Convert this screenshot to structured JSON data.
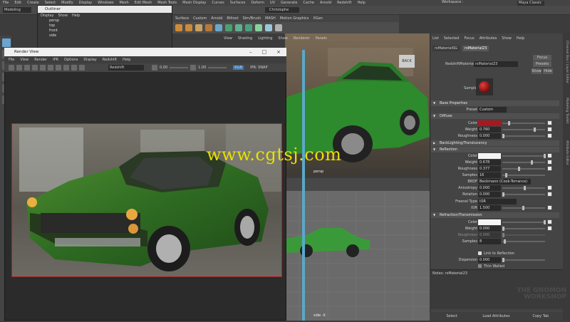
{
  "menubar": [
    "File",
    "Edit",
    "Create",
    "Select",
    "Modify",
    "Display",
    "Windows",
    "Mesh",
    "Edit Mesh",
    "Mesh Tools",
    "Mesh Display",
    "Curves",
    "Surfaces",
    "Deform",
    "UV",
    "Generate",
    "Cache",
    "Arnold",
    "Redshift",
    "Help"
  ],
  "workspace": {
    "label": "Workspace :",
    "value": "Maya Classic"
  },
  "status": {
    "mode": "Modeling",
    "user": "Christophe"
  },
  "shelf_tabs": [
    "Surface",
    "Custom",
    "Arnold",
    "Bifrost",
    "Sim/Brush",
    "MASH",
    "Motion Graphics",
    "XGen"
  ],
  "outliner": {
    "title": "Outliner",
    "menus": [
      "Display",
      "Show",
      "Help"
    ],
    "items": [
      "persp",
      "top",
      "front",
      "side"
    ]
  },
  "render_view": {
    "title": "Render View",
    "menus": [
      "File",
      "View",
      "Render",
      "IPR",
      "Options",
      "Display",
      "Redshift",
      "Help"
    ],
    "renderer": "Redshift",
    "exposure": "0.00",
    "gamma": "1.00",
    "mode": "RGB",
    "ipr_label": "IPR: SNAP"
  },
  "viewport": {
    "menus": [
      "View",
      "Shading",
      "Lighting",
      "Show",
      "Renderer",
      "Panels"
    ],
    "label": "persp",
    "side_label": "side -X"
  },
  "attribute_editor": {
    "menus": [
      "List",
      "Selected",
      "Focus",
      "Attributes",
      "Show",
      "Help"
    ],
    "tabs": [
      "rsMaterialSG",
      "rsMaterial23"
    ],
    "material_label": "RedshiftMaterial:",
    "material_name": "rsMaterial23",
    "buttons": {
      "focus": "Focus",
      "presets": "Presets",
      "show": "Show",
      "hide": "Hide"
    },
    "sample_label": "Sample",
    "base_properties": "Base Properties",
    "preset_label": "Preset",
    "preset_value": "Custom",
    "diffuse": {
      "title": "Diffuse",
      "color_label": "Color",
      "weight_label": "Weight",
      "weight": "0.760",
      "roughness_label": "Roughness",
      "roughness": "0.000",
      "diffuse_color": "#a81820"
    },
    "backlighting": "BackLighting/Translucency",
    "reflection": {
      "title": "Reflection",
      "color_label": "Color",
      "weight_label": "Weight",
      "weight": "0.678",
      "roughness_label": "Roughness",
      "roughness": "0.377",
      "samples_label": "Samples",
      "samples": "16",
      "brdf_label": "BRDF",
      "brdf": "Beckmann (Cook-Torrance)",
      "anisotropy_label": "Anisotropy",
      "anisotropy": "0.000",
      "rotation_label": "Rotation",
      "rotation": "0.000",
      "fresnel_label": "Fresnel Type",
      "fresnel": "IOR",
      "ior_label": "IOR",
      "ior": "1.500"
    },
    "refraction": {
      "title": "Refraction/Transmission",
      "color_label": "Color",
      "weight_label": "Weight",
      "weight": "0.000",
      "roughness_label": "Roughness",
      "roughness": "0.000",
      "samples_label": "Samples",
      "samples": "8",
      "link_label": "Link to Reflection",
      "dispersion_label": "Dispersion",
      "dispersion": "0.000",
      "thin_label": "Thin Walled"
    },
    "notes_label": "Notes: rsMaterial23",
    "bottom": [
      "Select",
      "Load Attributes",
      "Copy Tab"
    ]
  },
  "side_strip": [
    "Channel Box / Layer Editor",
    "Modeling Toolkit",
    "Attribute Editor"
  ],
  "watermark": "www.cgtsj.com",
  "brand": "THE GNOMON WORKSHOP"
}
